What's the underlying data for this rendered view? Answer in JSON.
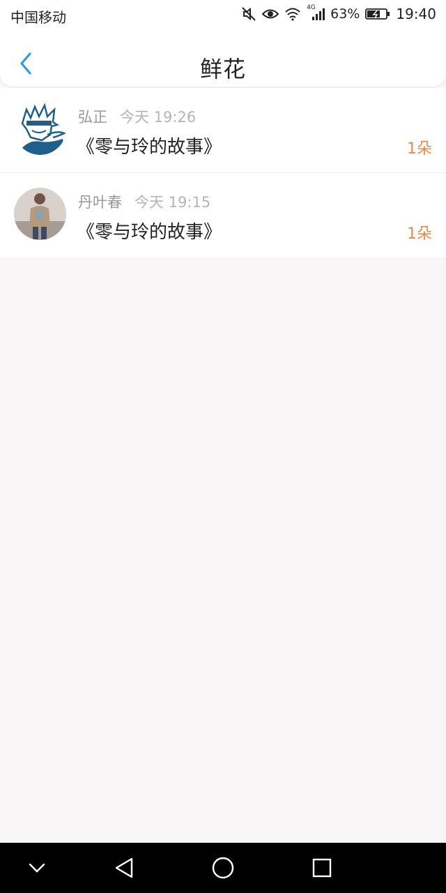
{
  "status_bar": {
    "carrier": "中国移动",
    "network": "4G",
    "battery_percent": "63%",
    "time": "19:40",
    "icons": [
      "mute-icon",
      "eye-icon",
      "wifi-icon",
      "signal-icon",
      "battery-charging-icon"
    ]
  },
  "header": {
    "back_icon": "chevron-left-icon",
    "title": "鲜花"
  },
  "records": [
    {
      "name": "弘正",
      "time": "今天 19:26",
      "book": "《零与玲的故事》",
      "count": "1朵",
      "avatar": "anime-avatar"
    },
    {
      "name": "丹叶春",
      "time": "今天 19:15",
      "book": "《零与玲的故事》",
      "count": "1朵",
      "avatar": "photo-avatar"
    }
  ],
  "colors": {
    "accent": "#2f9ae6",
    "count": "#e58a47",
    "background": "#f8f6f7"
  },
  "system_nav": [
    "chevron-down-icon",
    "back-triangle-icon",
    "home-circle-icon",
    "recents-square-icon"
  ]
}
